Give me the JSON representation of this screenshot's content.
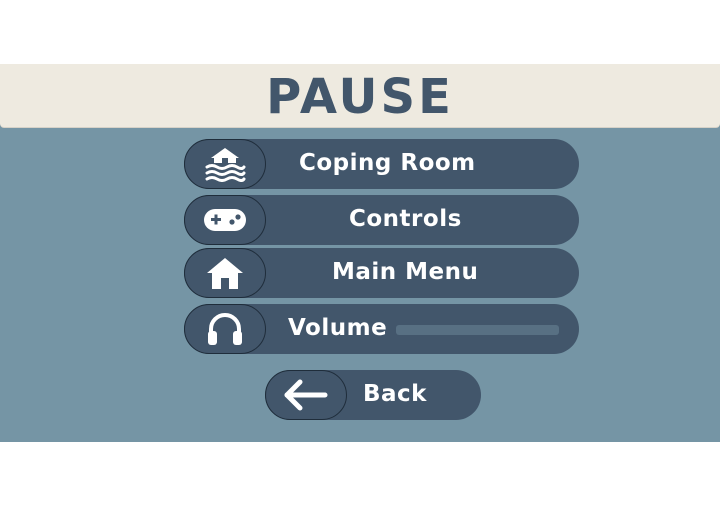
{
  "header": {
    "title": "PAUSE"
  },
  "menu": {
    "items": [
      {
        "label": "Coping Room",
        "icon": "house-flood-icon"
      },
      {
        "label": "Controls",
        "icon": "gamepad-icon"
      },
      {
        "label": "Main Menu",
        "icon": "home-icon"
      },
      {
        "label": "Volume",
        "icon": "headphones-icon"
      }
    ],
    "volume_level": null,
    "back": {
      "label": "Back",
      "icon": "arrow-left-icon"
    }
  },
  "colors": {
    "panel": "#7595a5",
    "header_background": "#eeeae0",
    "title_text": "#42566b",
    "button": "#42566b",
    "button_text": "#ffffff"
  }
}
